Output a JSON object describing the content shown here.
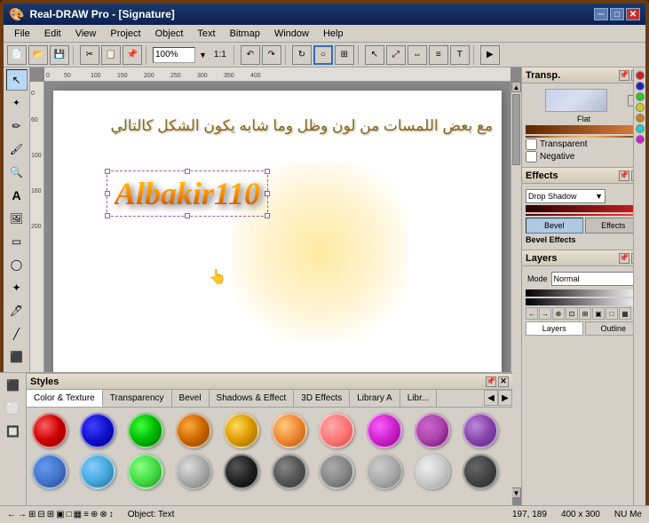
{
  "titleBar": {
    "title": "Real-DRAW Pro - [Signature]",
    "icon": "🎨",
    "minBtn": "─",
    "maxBtn": "□",
    "closeBtn": "✕"
  },
  "menuBar": {
    "items": [
      "File",
      "Edit",
      "View",
      "Project",
      "Object",
      "Text",
      "Bitmap",
      "Window",
      "Help"
    ]
  },
  "toolbar": {
    "zoom": "100%",
    "ratio": "1:1"
  },
  "canvas": {
    "title": "Signature",
    "arabicText": "مع بعض اللمسات من لون وظل وما شابه يكون الشكل كالتالي",
    "albakirText": "Albakir110",
    "coords": "197, 189",
    "size": "400 x 300"
  },
  "transpPanel": {
    "title": "Transp.",
    "previewLabel": "Flat",
    "transparentLabel": "Transparent",
    "negativeLabel": "Negative"
  },
  "effectsPanel": {
    "title": "Effects",
    "dropdownValue": "Drop Shadow",
    "bevelLabel": "Bevel Effects",
    "bevelBtn": "Bevel",
    "effectsBtn": "Effects"
  },
  "layersPanel": {
    "title": "Layers",
    "modeLabel": "Normal",
    "layersTabLabel": "Layers",
    "outlineTabLabel": "Outline"
  },
  "stylesPanel": {
    "title": "Styles",
    "tabs": [
      "Color & Texture",
      "Transparency",
      "Bevel",
      "Shadows & Effect",
      "3D Effects",
      "Library A",
      "Libr..."
    ]
  },
  "statusBar": {
    "objectType": "Object: Text",
    "coords": "197, 189",
    "size": "400 x 300",
    "mode": "NU Me"
  },
  "swatches": [
    "#cc0000",
    "#1010cc",
    "#00bb00",
    "#cc6600",
    "#dd9900",
    "#ee8833",
    "#ff7777",
    "#cc22cc",
    "#aa44aa",
    "#8844aa",
    "#4477cc",
    "#44aadd",
    "#44dd44",
    "#aaaaaa",
    "#222222",
    "#555555",
    "#888888",
    "#aaaaaa",
    "#cccccc",
    "#555555"
  ]
}
